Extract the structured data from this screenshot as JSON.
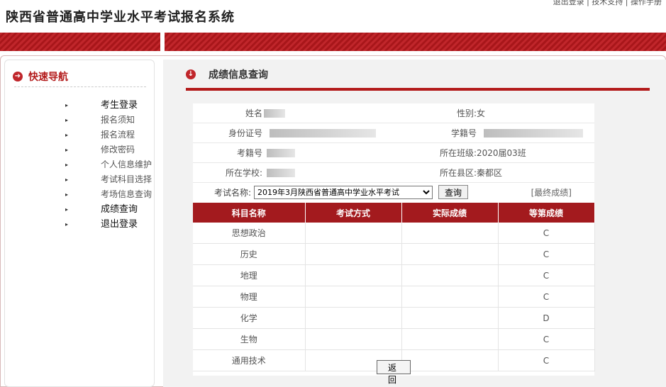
{
  "header": {
    "title": "陕西省普通高中学业水平考试报名系统",
    "top_links": "退出登录 | 技术支持 | 操作手册"
  },
  "sidebar": {
    "title": "快速导航",
    "items": [
      {
        "label": "考生登录"
      },
      {
        "label": "报名须知"
      },
      {
        "label": "报名流程"
      },
      {
        "label": "修改密码"
      },
      {
        "label": "个人信息维护"
      },
      {
        "label": "考试科目选择"
      },
      {
        "label": "考场信息查询"
      },
      {
        "label": "成绩查询"
      },
      {
        "label": "退出登录"
      }
    ]
  },
  "main": {
    "section_title": "成绩信息查询",
    "info": {
      "name_label": "姓名",
      "gender_label": "性别:",
      "gender_value": "女",
      "id_label": "身份证号",
      "student_no_label": "学籍号",
      "exam_no_label": "考籍号",
      "class_label": "所在班级:",
      "class_value": "2020届03班",
      "school_label": "所在学校:",
      "county_label": "所在县区:",
      "county_value": "秦都区"
    },
    "exam": {
      "label": "考试名称:",
      "selected": "2019年3月陕西省普通高中学业水平考试",
      "query_button": "查询",
      "final_link": "[最终成绩]"
    },
    "table": {
      "headers": [
        "科目名称",
        "考试方式",
        "实际成绩",
        "等第成绩"
      ],
      "rows": [
        {
          "subject": "思想政治",
          "method": "",
          "actual": "",
          "grade": "C"
        },
        {
          "subject": "历史",
          "method": "",
          "actual": "",
          "grade": "C"
        },
        {
          "subject": "地理",
          "method": "",
          "actual": "",
          "grade": "C"
        },
        {
          "subject": "物理",
          "method": "",
          "actual": "",
          "grade": "C"
        },
        {
          "subject": "化学",
          "method": "",
          "actual": "",
          "grade": "D"
        },
        {
          "subject": "生物",
          "method": "",
          "actual": "",
          "grade": "C"
        },
        {
          "subject": "通用技术",
          "method": "",
          "actual": "",
          "grade": "C"
        }
      ]
    },
    "back_button": "返 回"
  }
}
